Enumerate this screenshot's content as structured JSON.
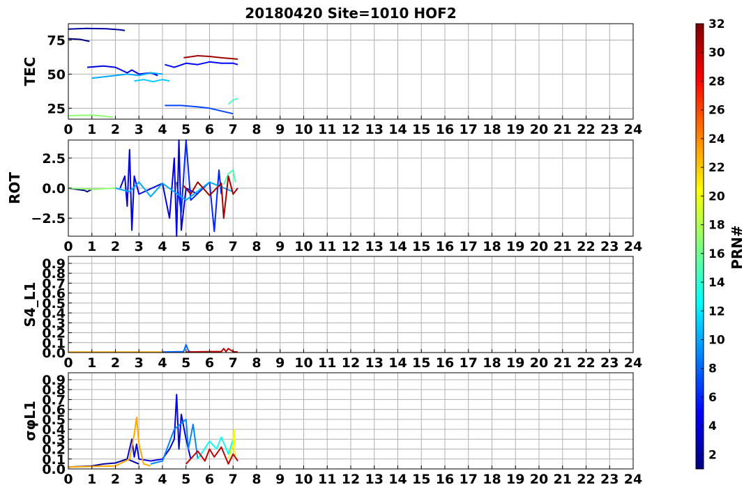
{
  "chart_data": {
    "title": "20180420 Site=1010 HOF2",
    "x_ticks": [
      "0",
      "1",
      "2",
      "3",
      "4",
      "5",
      "6",
      "7",
      "8",
      "9",
      "10",
      "11",
      "12",
      "13",
      "14",
      "15",
      "16",
      "17",
      "18",
      "19",
      "20",
      "21",
      "22",
      "23",
      "24"
    ],
    "xlim": [
      0,
      24
    ],
    "grid": true,
    "panels": [
      {
        "type": "line",
        "ylabel": "TEC",
        "ylim": [
          17,
          87
        ],
        "yticks": [
          25,
          50,
          75
        ],
        "ytick_labels": [
          "25",
          "50",
          "75"
        ],
        "series": [
          {
            "prn": 1,
            "x": [
              0.0,
              0.5,
              0.9
            ],
            "y": [
              76,
              75.5,
              74
            ]
          },
          {
            "prn": 2,
            "x": [
              0.0,
              0.8,
              1.6,
              2.2,
              2.4
            ],
            "y": [
              83,
              83.5,
              83.3,
              82.5,
              82
            ]
          },
          {
            "prn": 5,
            "x": [
              4.1,
              4.5,
              5.0,
              5.5,
              6.0,
              6.5,
              7.0,
              7.2
            ],
            "y": [
              57,
              55,
              58,
              57,
              59,
              58,
              58,
              57
            ]
          },
          {
            "prn": 4,
            "x": [
              0.8,
              1.5,
              2.0,
              2.5,
              2.7,
              3.0,
              3.5,
              3.8
            ],
            "y": [
              55,
              56,
              55,
              51,
              53,
              50,
              51,
              49
            ]
          },
          {
            "prn": 7,
            "x": [
              4.1,
              4.8,
              5.5,
              6.0,
              6.5,
              7.0
            ],
            "y": [
              27,
              27,
              26,
              25,
              23,
              21
            ]
          },
          {
            "prn": 11,
            "x": [
              2.8,
              3.2,
              3.6,
              4.0,
              4.3
            ],
            "y": [
              45,
              46,
              44.5,
              46,
              45
            ]
          },
          {
            "prn": 10,
            "x": [
              1.0,
              1.5,
              2.0,
              2.5,
              3.0,
              3.5,
              4.0
            ],
            "y": [
              47,
              48,
              49,
              50,
              49,
              51,
              50
            ]
          },
          {
            "prn": 17,
            "x": [
              0.0,
              1.0,
              1.9
            ],
            "y": [
              19.5,
              20,
              18.5
            ]
          },
          {
            "prn": 15,
            "x": [
              6.8,
              7.0,
              7.2
            ],
            "y": [
              28,
              31,
              32
            ]
          },
          {
            "prn": 31,
            "x": [
              4.9,
              5.5,
              6.0,
              6.5,
              7.2
            ],
            "y": [
              62,
              63.5,
              63,
              62,
              61
            ]
          }
        ]
      },
      {
        "type": "line",
        "ylabel": "ROT",
        "ylim": [
          -4,
          4
        ],
        "yticks": [
          -2.5,
          0.0,
          2.5
        ],
        "ytick_labels": [
          "−2.5",
          "0.0",
          "2.5"
        ],
        "series": [
          {
            "prn": 1,
            "x": [
              0.0,
              0.7,
              0.8,
              1.0
            ],
            "y": [
              0.0,
              -0.2,
              -0.3,
              -0.1
            ]
          },
          {
            "prn": 17,
            "x": [
              0.0,
              1.0,
              2.0
            ],
            "y": [
              0.0,
              -0.1,
              0.0
            ]
          },
          {
            "prn": 4,
            "x": [
              2.2,
              2.4,
              2.5,
              2.6,
              2.7,
              2.8,
              3.0,
              4.0,
              4.3,
              4.5,
              4.6,
              4.7,
              4.8,
              5.0,
              5.5
            ],
            "y": [
              0.0,
              1.0,
              -1.5,
              3.2,
              -3.5,
              1.0,
              -0.5,
              0.4,
              -2.5,
              2.5,
              -4.0,
              4.0,
              -3.5,
              0.0,
              -0.5
            ]
          },
          {
            "prn": 6,
            "x": [
              4.6,
              4.8,
              5.0,
              5.2,
              6.0,
              6.2,
              6.4,
              6.5
            ],
            "y": [
              0.5,
              -2.0,
              4.0,
              -1.0,
              0.5,
              -3.6,
              1.5,
              -0.5
            ]
          },
          {
            "prn": 10,
            "x": [
              2.0,
              2.6,
              3.0,
              3.5,
              4.0,
              5.0,
              6.0,
              7.0
            ],
            "y": [
              0.0,
              -0.3,
              0.5,
              -0.7,
              0.4,
              -1.0,
              0.5,
              -0.3
            ]
          },
          {
            "prn": 15,
            "x": [
              6.6,
              6.8,
              7.0,
              7.1
            ],
            "y": [
              0.3,
              1.2,
              1.5,
              0.5
            ]
          },
          {
            "prn": 31,
            "x": [
              4.9,
              5.2,
              5.5,
              6.0,
              6.5,
              6.6,
              6.8,
              7.0,
              7.2
            ],
            "y": [
              0.2,
              -0.5,
              0.5,
              -0.6,
              0.4,
              -2.5,
              1.0,
              -0.5,
              0.0
            ]
          }
        ]
      },
      {
        "type": "line",
        "ylabel": "S4_L1",
        "ylim": [
          0,
          0.97
        ],
        "yticks": [
          0.0,
          0.1,
          0.2,
          0.3,
          0.4,
          0.5,
          0.6,
          0.7,
          0.8,
          0.9
        ],
        "ytick_labels": [
          "0.0",
          "0.1",
          "0.2",
          "0.3",
          "0.4",
          "0.5",
          "0.6",
          "0.7",
          "0.8",
          "0.9"
        ],
        "series": [
          {
            "prn": 23,
            "x": [
              0.0,
              3.0,
              4.5
            ],
            "y": [
              0.005,
              0.005,
              0.005
            ]
          },
          {
            "prn": 8,
            "x": [
              4.0,
              4.9,
              5.0,
              5.1,
              5.2,
              6.0
            ],
            "y": [
              0.005,
              0.01,
              0.08,
              0.02,
              0.005,
              0.005
            ]
          },
          {
            "prn": 30,
            "x": [
              5.0,
              6.0,
              6.5,
              6.6,
              6.7,
              6.8,
              7.0,
              7.2
            ],
            "y": [
              0.005,
              0.01,
              0.01,
              0.04,
              0.01,
              0.04,
              0.01,
              0.005
            ]
          }
        ]
      },
      {
        "type": "line",
        "ylabel": "σφL1",
        "ylim": [
          0,
          0.97
        ],
        "yticks": [
          0.0,
          0.1,
          0.2,
          0.3,
          0.4,
          0.5,
          0.6,
          0.7,
          0.8,
          0.9
        ],
        "ytick_labels": [
          "0.0",
          "0.1",
          "0.2",
          "0.3",
          "0.4",
          "0.5",
          "0.6",
          "0.7",
          "0.8",
          "0.9"
        ],
        "series": [
          {
            "prn": 2,
            "x": [
              0.0,
              1.0,
              1.5,
              2.0,
              2.5,
              3.0
            ],
            "y": [
              0.02,
              0.03,
              0.05,
              0.06,
              0.1,
              0.05
            ]
          },
          {
            "prn": 4,
            "x": [
              2.5,
              2.7,
              2.8,
              2.9,
              3.0,
              3.5,
              4.0,
              4.3,
              4.5,
              4.6,
              4.7,
              4.8,
              5.0,
              5.2
            ],
            "y": [
              0.1,
              0.3,
              0.12,
              0.25,
              0.1,
              0.08,
              0.1,
              0.2,
              0.3,
              0.75,
              0.2,
              0.55,
              0.3,
              0.1
            ]
          },
          {
            "prn": 23,
            "x": [
              0.0,
              2.0,
              2.6,
              2.8,
              2.9,
              3.0,
              3.2,
              3.5
            ],
            "y": [
              0.02,
              0.03,
              0.1,
              0.35,
              0.52,
              0.25,
              0.05,
              0.03
            ]
          },
          {
            "prn": 9,
            "x": [
              3.5,
              4.0,
              4.5,
              5.0,
              5.1,
              5.3,
              5.5
            ],
            "y": [
              0.05,
              0.08,
              0.4,
              0.5,
              0.2,
              0.45,
              0.1
            ]
          },
          {
            "prn": 13,
            "x": [
              5.5,
              6.0,
              6.3,
              6.5,
              6.8,
              7.0
            ],
            "y": [
              0.1,
              0.28,
              0.2,
              0.32,
              0.15,
              0.3
            ]
          },
          {
            "prn": 20,
            "x": [
              6.8,
              7.0,
              7.05,
              7.1
            ],
            "y": [
              0.1,
              0.25,
              0.4,
              0.1
            ]
          },
          {
            "prn": 30,
            "x": [
              5.0,
              5.5,
              5.8,
              6.0,
              6.2,
              6.5,
              6.8,
              7.0,
              7.2
            ],
            "y": [
              0.05,
              0.18,
              0.08,
              0.2,
              0.12,
              0.22,
              0.05,
              0.15,
              0.08
            ]
          }
        ]
      }
    ],
    "colorbar": {
      "label": "PRN#",
      "min": 1,
      "max": 32,
      "ticks": [
        2,
        4,
        6,
        8,
        10,
        12,
        14,
        16,
        18,
        20,
        22,
        24,
        26,
        28,
        30,
        32
      ],
      "tick_labels": [
        "2",
        "4",
        "6",
        "8",
        "10",
        "12",
        "14",
        "16",
        "18",
        "20",
        "22",
        "24",
        "26",
        "28",
        "30",
        "32"
      ],
      "colormap": "jet",
      "colormap_stops": [
        "#00007f",
        "#0000ff",
        "#007fff",
        "#00ffff",
        "#7fff7f",
        "#ffff00",
        "#ff7f00",
        "#ff0000",
        "#7f0000"
      ]
    }
  }
}
